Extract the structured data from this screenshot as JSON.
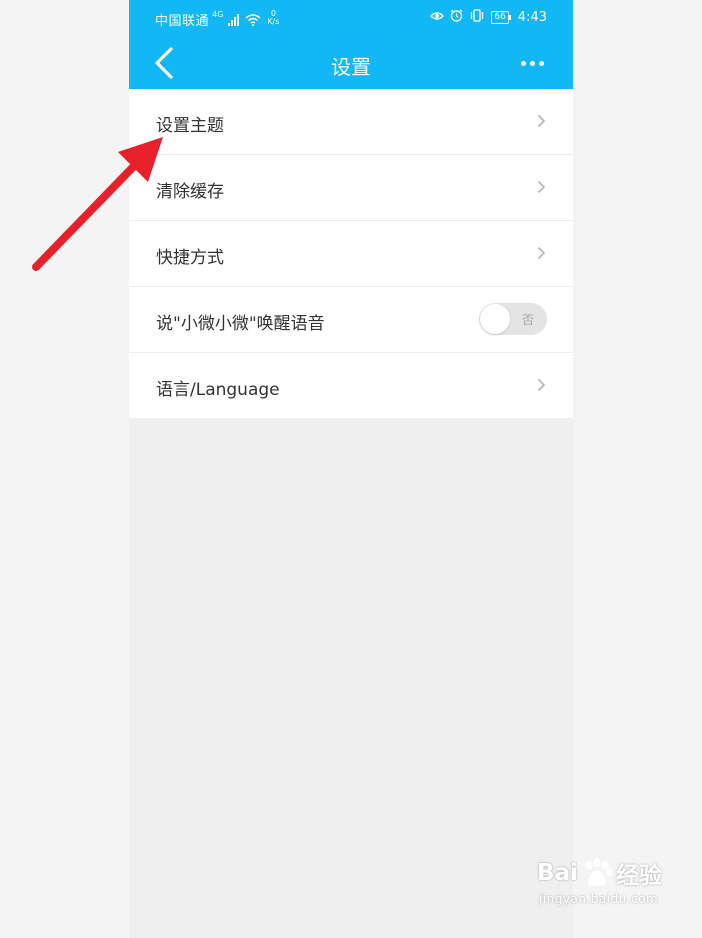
{
  "statusbar": {
    "carrier": "中国联通",
    "network_type": "4G",
    "net_speed_value": "0",
    "net_speed_unit": "K/s",
    "battery": "66",
    "time": "4:43"
  },
  "appbar": {
    "title": "设置"
  },
  "settings": [
    {
      "label": "设置主题",
      "control": "chevron"
    },
    {
      "label": "清除缓存",
      "control": "chevron"
    },
    {
      "label": "快捷方式",
      "control": "chevron"
    },
    {
      "label": "说\"小微小微\"唤醒语音",
      "control": "toggle",
      "toggle_text": "否",
      "toggle_on": false
    },
    {
      "label": "语言/Language",
      "control": "chevron"
    }
  ],
  "watermark": {
    "brand_left": "Bai",
    "brand_right": "经验",
    "url": "jingyan.baidu.com"
  },
  "colors": {
    "accent": "#12b7f5",
    "annotation_arrow": "#e8202a",
    "row_text": "#333333"
  }
}
